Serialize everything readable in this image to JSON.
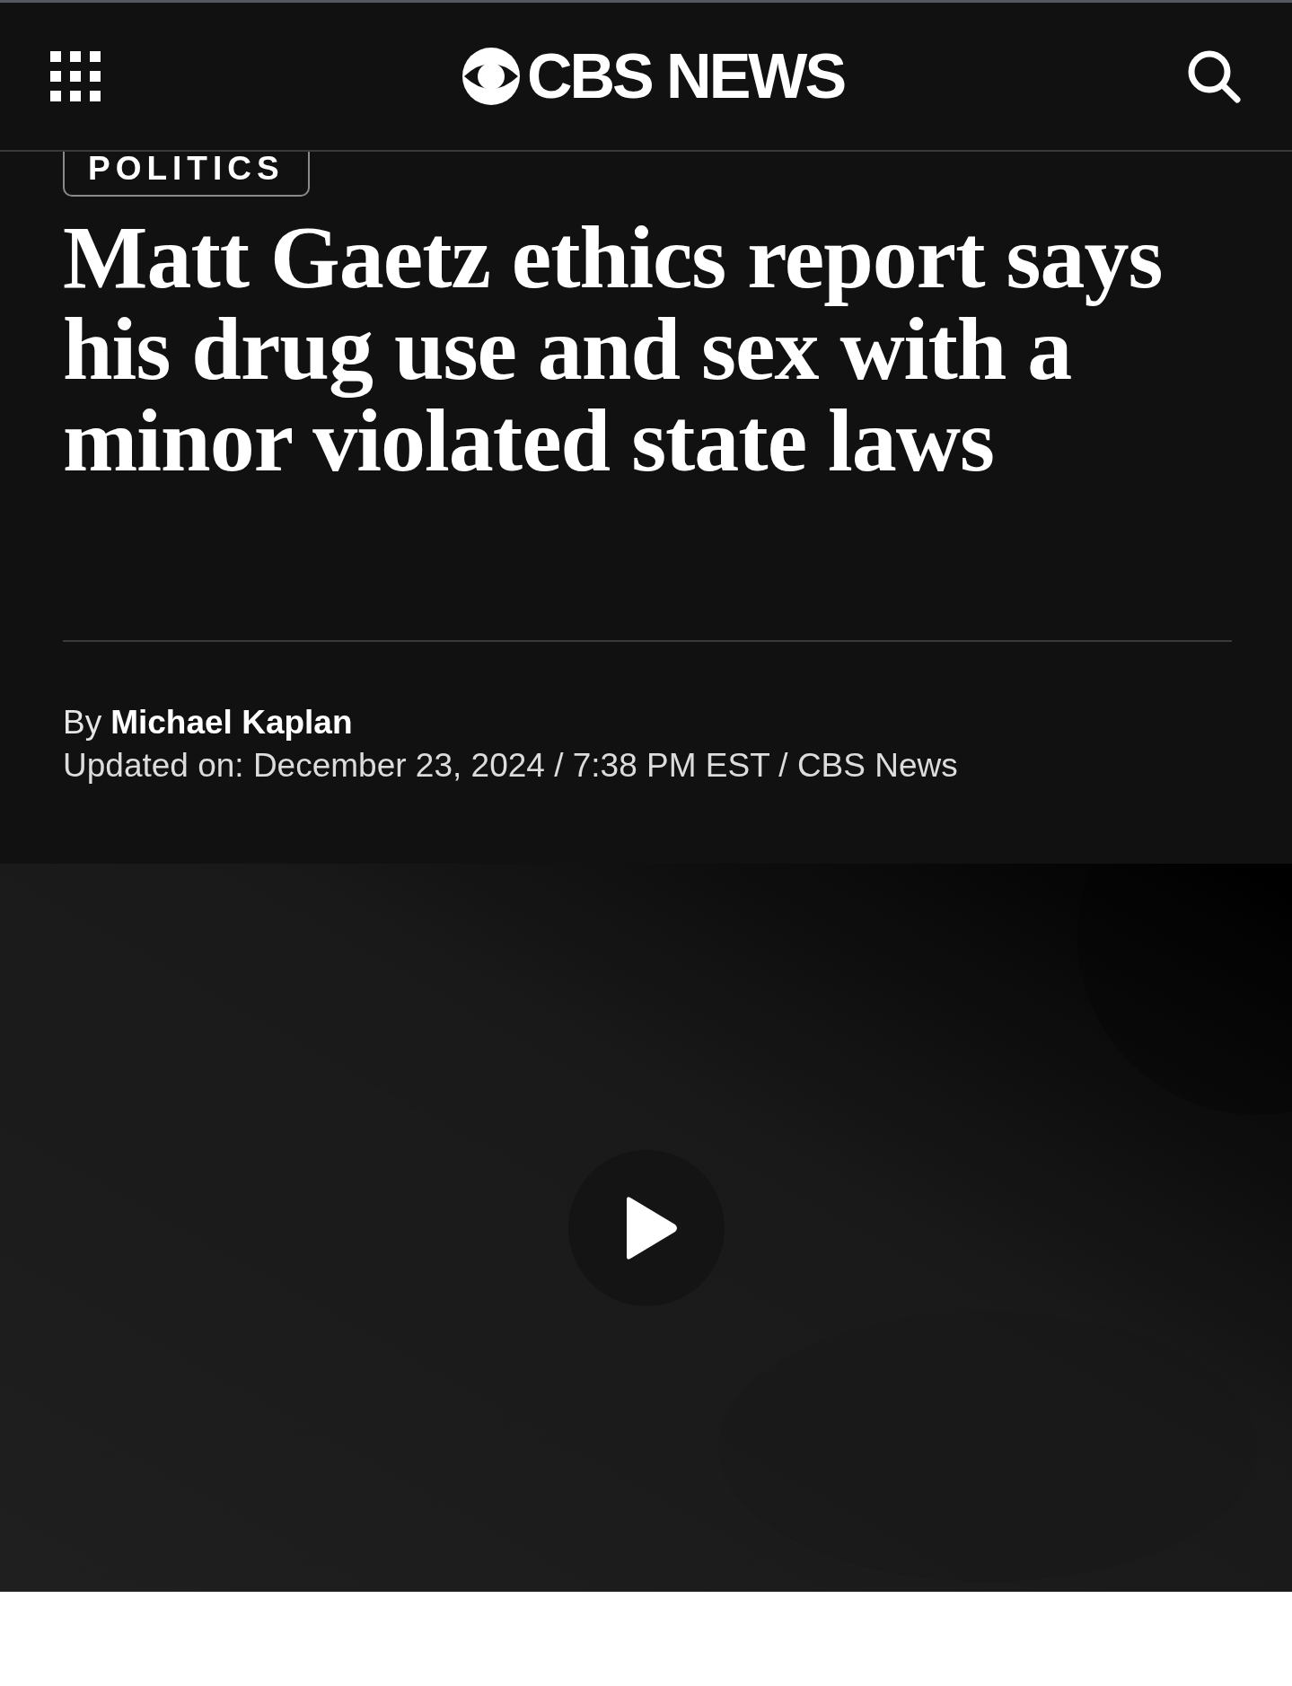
{
  "header": {
    "logo": "CBS NEWS"
  },
  "category": "POLITICS",
  "headline": "Matt Gaetz ethics report says his drug use and sex with a minor violated state laws",
  "byline": {
    "prefix": "By",
    "author": "Michael Kaplan"
  },
  "updated": "Updated on: December 23, 2024 / 7:38 PM EST / CBS News"
}
